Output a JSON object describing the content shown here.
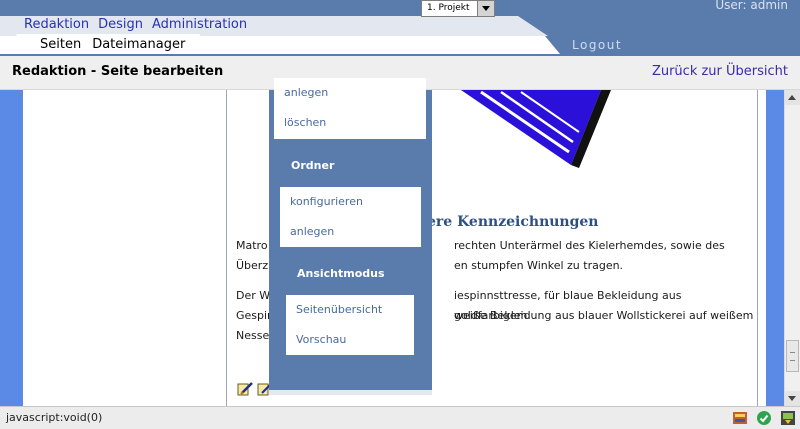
{
  "header": {
    "project_selector": "1. Projekt",
    "user_label": "User: admin",
    "logout": "Logout",
    "main_nav": [
      "Redaktion",
      "Design",
      "Administration"
    ],
    "sub_nav": [
      "Seiten",
      "Dateimanager"
    ]
  },
  "title_bar": {
    "title": "Redaktion - Seite bearbeiten",
    "back_link": "Zurück zur Übersicht"
  },
  "menu": {
    "top_items": [
      "anlegen",
      "löschen"
    ],
    "sections": [
      {
        "heading": "Ordner",
        "items": [
          "konfigurieren",
          "anlegen"
        ]
      },
      {
        "heading": "Ansichtmodus",
        "items": [
          "Seitenübersicht",
          "Vorschau"
        ]
      }
    ]
  },
  "document": {
    "heading_visible": "ere Kennzeichnungen",
    "para1": {
      "left": [
        "Matro",
        "Überz"
      ],
      "right": [
        "rechten Unterärmel des Kielerhemdes, sowie des",
        "en stumpfen Winkel zu tragen."
      ]
    },
    "para2": {
      "left": [
        "Der W",
        "Gespin",
        "Nesse"
      ],
      "right": [
        "iespinnsttresse, für blaue Bekleidung aus goldfarbigem",
        "weiße Bekleidung aus blauer Wollstickerei auf weißem",
        ""
      ]
    }
  },
  "status_bar": {
    "text": "javascript:void(0)"
  },
  "colors": {
    "header_blue": "#5a7cad",
    "side_stripe": "#5a8ae6",
    "nav_link": "#2a30b8",
    "heading": "#2d4f85"
  }
}
